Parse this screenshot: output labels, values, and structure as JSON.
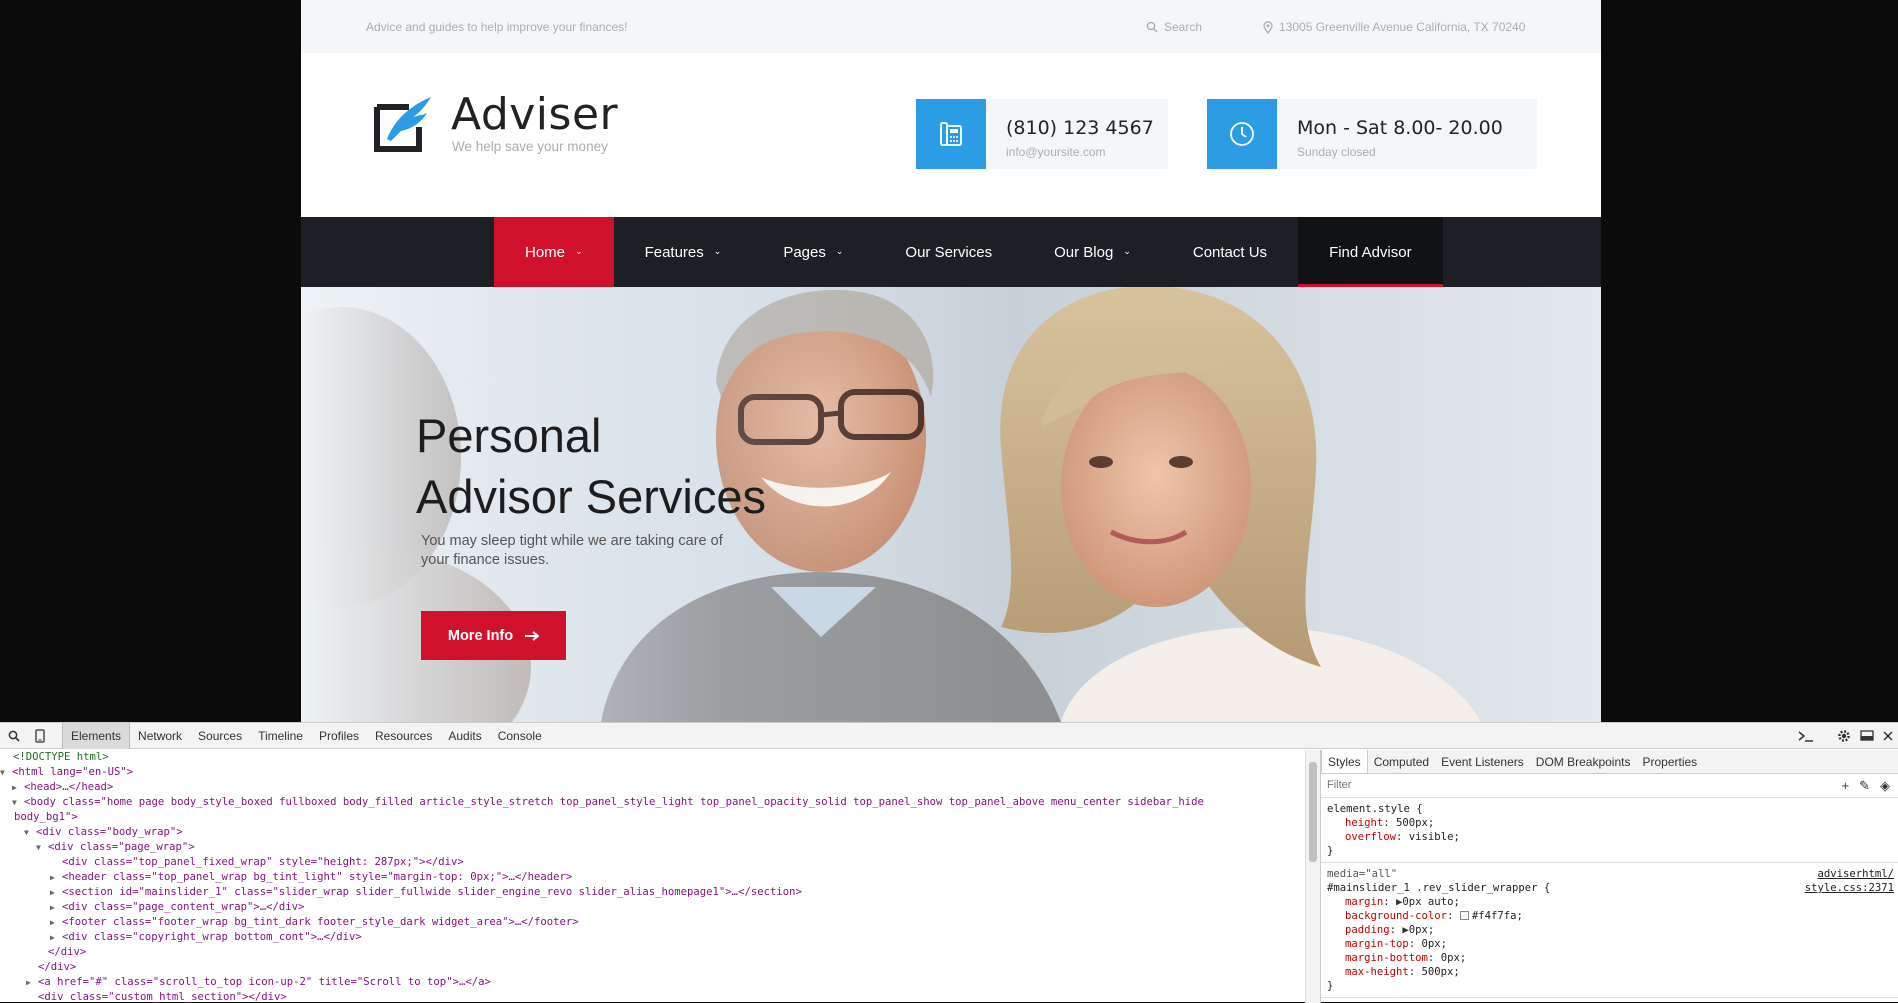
{
  "site": {
    "topbar": {
      "tagline": "Advice and guides to help improve your finances!",
      "search_label": "Search",
      "address": "13005 Greenville Avenue California, TX 70240"
    },
    "brand": {
      "name": "Adviser",
      "slogan": "We help save your money"
    },
    "phone": {
      "number": "(810) 123 4567",
      "email": "info@yoursite.com"
    },
    "hours": {
      "time": "Mon - Sat 8.00- 20.00",
      "note": "Sunday closed"
    },
    "nav": [
      {
        "label": "Home",
        "dropdown": true
      },
      {
        "label": "Features",
        "dropdown": true
      },
      {
        "label": "Pages",
        "dropdown": true
      },
      {
        "label": "Our Services",
        "dropdown": false
      },
      {
        "label": "Our Blog",
        "dropdown": true
      },
      {
        "label": "Contact Us",
        "dropdown": false
      },
      {
        "label": "Find Advisor",
        "dropdown": false
      }
    ],
    "hero": {
      "title_line1": "Personal",
      "title_line2": "Advisor Services",
      "subtitle": "You may sleep tight while we are taking care of your finance issues.",
      "cta": "More Info"
    },
    "colors": {
      "accent_red": "#d0112b",
      "accent_blue": "#2c9ce4",
      "nav_bg": "#1c1f24",
      "topbar_bg": "#f4f7fa"
    }
  },
  "devtools": {
    "tabs": [
      "Elements",
      "Network",
      "Sources",
      "Timeline",
      "Profiles",
      "Resources",
      "Audits",
      "Console"
    ],
    "active_tab": "Elements",
    "dom_lines": [
      "<!DOCTYPE html>",
      "<html lang=\"en-US\">",
      "<head>…</head>",
      "<body class=\"home page body_style_boxed fullboxed body_filled article_style_stretch top_panel_style_light top_panel_opacity_solid top_panel_show top_panel_above menu_center sidebar_hide",
      "body_bg1\">",
      "<div class=\"body_wrap\">",
      "<div class=\"page_wrap\">",
      "<div class=\"top_panel_fixed_wrap\" style=\"height: 287px;\"></div>",
      "<header class=\"top_panel_wrap bg_tint_light\" style=\"margin-top: 0px;\">…</header>",
      "<section id=\"mainslider_1\" class=\"slider_wrap slider_fullwide slider_engine_revo slider_alias_homepage1\">…</section>",
      "<div class=\"page_content_wrap\">…</div>",
      "<footer class=\"footer_wrap bg_tint_dark footer_style_dark widget_area\">…</footer>",
      "<div class=\"copyright_wrap bottom_cont\">…</div>",
      "</div>",
      "</div>",
      "<a href=\"#\" class=\"scroll_to_top icon-up-2\" title=\"Scroll to top\">…</a>",
      "<div class=\"custom_html_section\"></div>"
    ],
    "styles_tabs": [
      "Styles",
      "Computed",
      "Event Listeners",
      "DOM Breakpoints",
      "Properties"
    ],
    "filter_placeholder": "Filter",
    "rule1": {
      "selector": "element.style {",
      "props": [
        {
          "name": "height",
          "value": "500px;"
        },
        {
          "name": "overflow",
          "value": "visible;"
        }
      ],
      "close": "}"
    },
    "rule2": {
      "media": "media=\"all\"",
      "selector": "#mainslider_1 .rev_slider_wrapper {",
      "source1": "adviserhtml/",
      "source2": "style.css:2371",
      "props": [
        {
          "name": "margin",
          "value": "0px auto;"
        },
        {
          "name": "background-color",
          "value": "#f4f7fa;"
        },
        {
          "name": "padding",
          "value": "0px;"
        },
        {
          "name": "margin-top",
          "value": "0px;"
        },
        {
          "name": "margin-bottom",
          "value": "0px;"
        },
        {
          "name": "max-height",
          "value": "500px;"
        }
      ],
      "close": "}"
    }
  }
}
